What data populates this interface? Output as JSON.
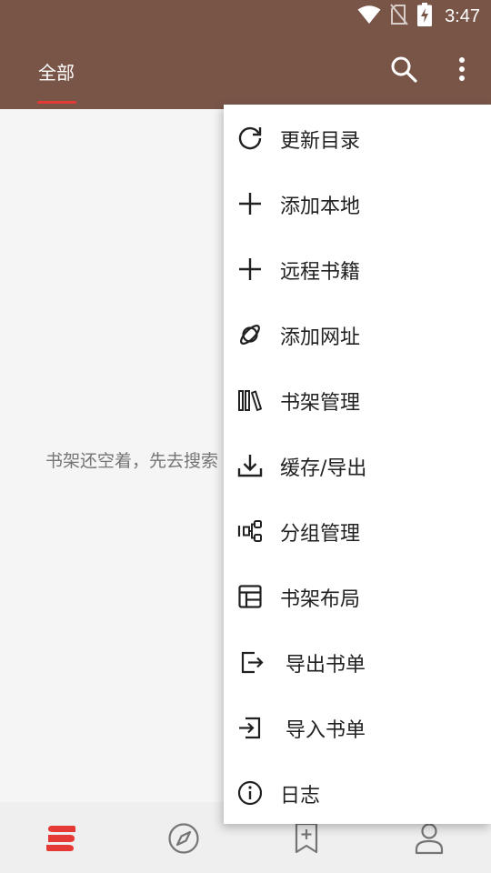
{
  "status_bar": {
    "time": "3:47",
    "icons": [
      "wifi-icon",
      "no-sim-icon",
      "battery-charging-icon"
    ]
  },
  "toolbar": {
    "tab_label": "全部",
    "accent_color": "#795548",
    "indicator_color": "#e53935",
    "actions": [
      "search-icon",
      "more-vert-icon"
    ]
  },
  "content": {
    "empty_message": "书架还空着，先去搜索"
  },
  "menu": {
    "items": [
      {
        "label": "更新目录",
        "icon": "refresh-icon"
      },
      {
        "label": "添加本地",
        "icon": "plus-icon"
      },
      {
        "label": "远程书籍",
        "icon": "plus-icon"
      },
      {
        "label": "添加网址",
        "icon": "planet-icon"
      },
      {
        "label": "书架管理",
        "icon": "books-icon"
      },
      {
        "label": "缓存/导出",
        "icon": "download-icon"
      },
      {
        "label": "分组管理",
        "icon": "group-icon"
      },
      {
        "label": "书架布局",
        "icon": "layout-icon"
      },
      {
        "label": "导出书单",
        "icon": "export-icon"
      },
      {
        "label": "导入书单",
        "icon": "import-icon"
      },
      {
        "label": "日志",
        "icon": "info-icon"
      }
    ]
  },
  "bottom_nav": {
    "items": [
      "bookshelf-icon",
      "explore-icon",
      "rss-bookmark-icon",
      "profile-icon"
    ],
    "active_color": "#e53935",
    "inactive_color": "#757575"
  }
}
